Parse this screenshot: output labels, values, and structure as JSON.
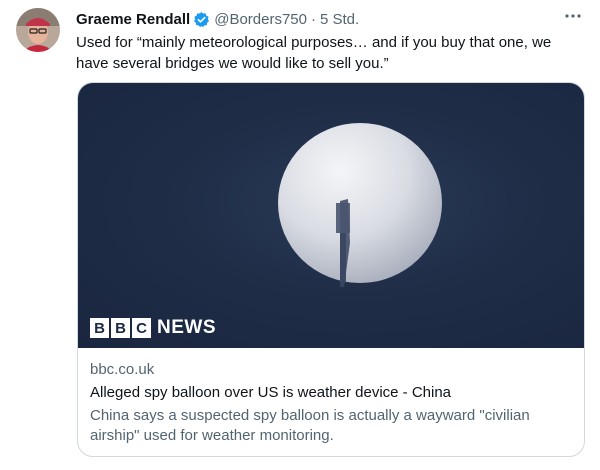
{
  "tweet": {
    "author": {
      "display_name": "Graeme Rendall",
      "handle": "@Borders750",
      "verified": true
    },
    "separator": "·",
    "time": "5 Std.",
    "more_icon": "more-horizontal-icon",
    "text": "Used for “mainly meteorological purposes… and if you buy that one, we have several bridges we would like to sell you.”"
  },
  "card": {
    "image_logo": {
      "letters": [
        "B",
        "B",
        "C"
      ],
      "word": "NEWS"
    },
    "domain": "bbc.co.uk",
    "title": "Alleged spy balloon over US is weather device - China",
    "description": "China says a suspected spy balloon is actually a wayward \"civilian airship\" used for weather monitoring."
  },
  "colors": {
    "verified": "#1d9bf0",
    "secondary_text": "#536471",
    "primary_text": "#0f1419",
    "card_border": "#cfd9de",
    "sky": "#1f2d47"
  }
}
